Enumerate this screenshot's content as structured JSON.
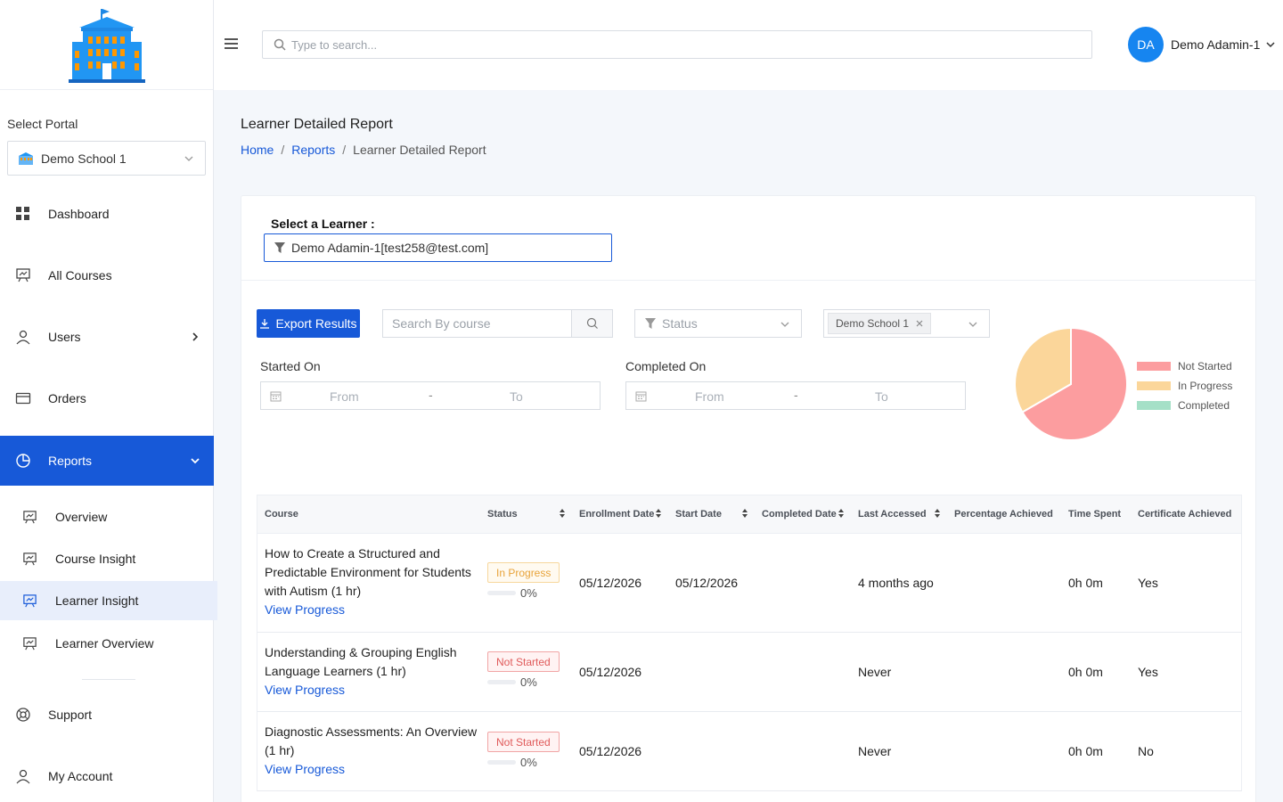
{
  "colors": {
    "primary": "#1759d8",
    "avatar": "#1685f0",
    "not_started": "#fc9d9f",
    "in_progress": "#fbd69a",
    "completed": "#a5e0c7"
  },
  "sidebar": {
    "portal_label": "Select Portal",
    "portal_value": "Demo School 1",
    "nav": [
      {
        "label": "Dashboard",
        "icon": "grid-icon"
      },
      {
        "label": "All Courses",
        "icon": "presentation-icon"
      },
      {
        "label": "Users",
        "icon": "user-icon"
      },
      {
        "label": "Orders",
        "icon": "card-icon"
      },
      {
        "label": "Reports",
        "icon": "pie-icon"
      }
    ],
    "sub": [
      {
        "label": "Overview"
      },
      {
        "label": "Course Insight"
      },
      {
        "label": "Learner Insight"
      },
      {
        "label": "Learner Overview"
      }
    ],
    "bottom": [
      {
        "label": "Support",
        "icon": "lifebuoy-icon"
      },
      {
        "label": "My Account",
        "icon": "user-icon"
      }
    ]
  },
  "header": {
    "search_placeholder": "Type to search...",
    "avatar_initials": "DA",
    "user_name": "Demo Adamin-1"
  },
  "page": {
    "title": "Learner Detailed Report",
    "breadcrumb": [
      "Home",
      "Reports",
      "Learner Detailed Report"
    ],
    "breadcrumb_sep": "/"
  },
  "filters": {
    "learner_label": "Select a Learner :",
    "learner_value": "Demo Adamin-1[test258@test.com]",
    "export_label": "Export Results",
    "course_search_placeholder": "Search By course",
    "status_placeholder": "Status",
    "school_tag": "Demo School 1",
    "started_label": "Started On",
    "completed_label": "Completed On",
    "from": "From",
    "to": "To",
    "dash": "-"
  },
  "chart_data": {
    "type": "pie",
    "labels": [
      "Not Started",
      "In Progress",
      "Completed"
    ],
    "values": [
      2,
      1,
      0
    ],
    "colors": [
      "#fc9d9f",
      "#fbd69a",
      "#a5e0c7"
    ],
    "legend": "right"
  },
  "table": {
    "columns": [
      "Course",
      "Status",
      "Enrollment Date",
      "Start Date",
      "Completed Date",
      "Last Accessed",
      "Percentage Achieved",
      "Time Spent",
      "Certificate Achieved"
    ],
    "rows": [
      {
        "course": "How to Create a Structured and Predictable Environment for Students with Autism (1 hr)",
        "link": "View Progress",
        "status": "In Progress",
        "progress": "0%",
        "enrollment": "05/12/2026",
        "start": "05/12/2026",
        "completed": "",
        "last": "4 months ago",
        "time": "0h 0m",
        "cert": "Yes"
      },
      {
        "course": "Understanding & Grouping English Language Learners (1 hr)",
        "link": "View Progress",
        "status": "Not Started",
        "progress": "0%",
        "enrollment": "05/12/2026",
        "start": "",
        "completed": "",
        "last": "Never",
        "time": "0h 0m",
        "cert": "Yes"
      },
      {
        "course": "Diagnostic Assessments: An Overview (1 hr)",
        "link": "View Progress",
        "status": "Not Started",
        "progress": "0%",
        "enrollment": "05/12/2026",
        "start": "",
        "completed": "",
        "last": "Never",
        "time": "0h 0m",
        "cert": "No"
      }
    ]
  }
}
